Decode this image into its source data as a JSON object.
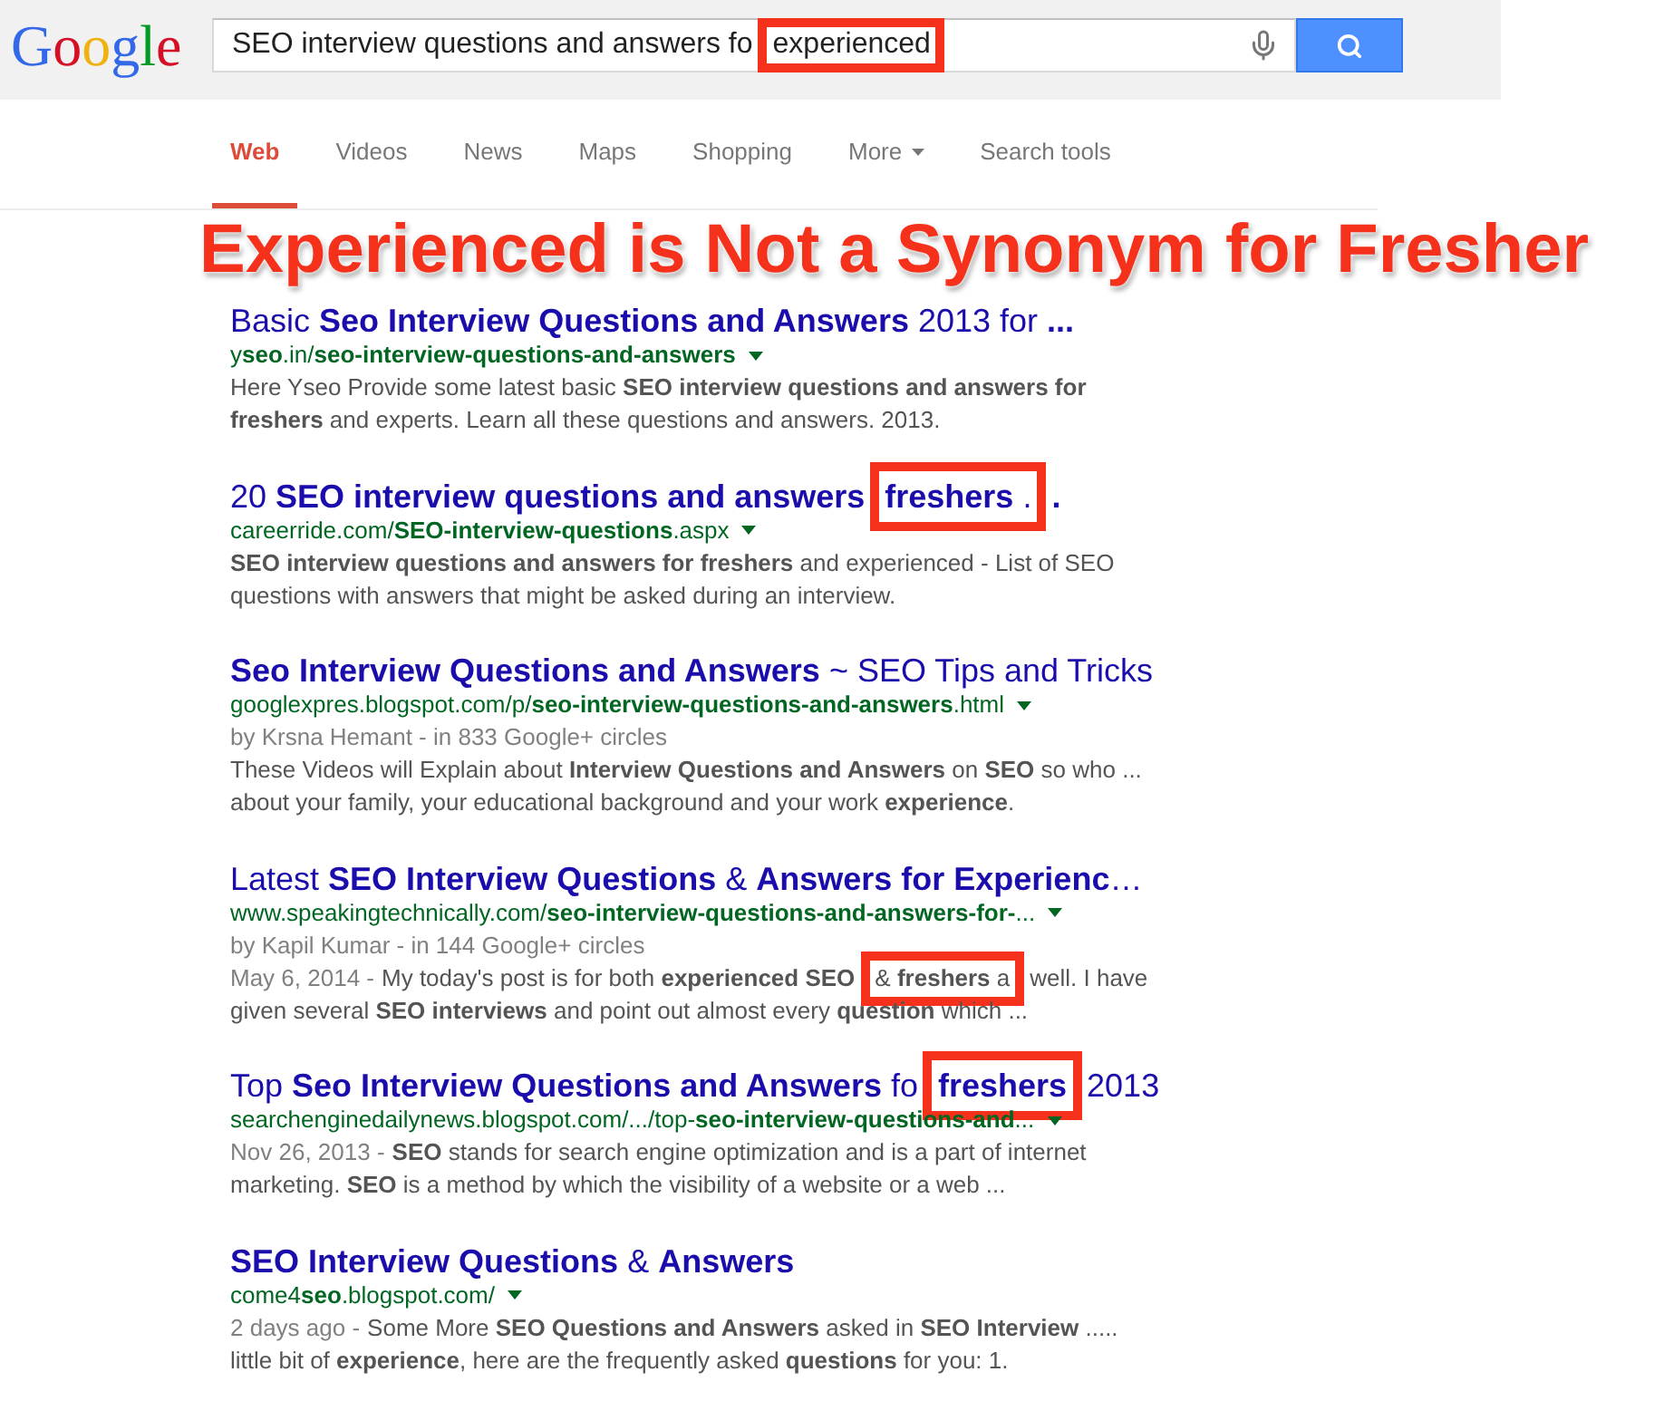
{
  "header": {
    "logo": "Google",
    "search": {
      "query": [
        {
          "text": "SEO interview questions and answers fo",
          "highlighted": false
        },
        {
          "text": "experienced",
          "highlighted": true
        }
      ]
    }
  },
  "tabs": [
    {
      "label": "Web",
      "selected": true,
      "kind": "tab"
    },
    {
      "label": "Videos",
      "selected": false,
      "kind": "tab"
    },
    {
      "label": "News",
      "selected": false,
      "kind": "tab"
    },
    {
      "label": "Maps",
      "selected": false,
      "kind": "tab"
    },
    {
      "label": "Shopping",
      "selected": false,
      "kind": "tab"
    },
    {
      "label": "More",
      "selected": false,
      "kind": "menu"
    },
    {
      "label": "Search tools",
      "selected": false,
      "kind": "tab"
    }
  ],
  "annotation": "Experienced is Not a Synonym for Fresher",
  "results": [
    {
      "title": [
        {
          "text": "Basic **Seo Interview Questions and Answers** 2013 for **...**",
          "highlighted": false
        }
      ],
      "url": "y**seo**.in/**seo-interview-questions-and-answers**",
      "snippet": [
        {
          "text": "Here Yseo Provide some latest basic **SEO interview questions and answers for freshers** and experts. Learn all these questions and answers. 2013.",
          "highlighted": false
        }
      ]
    },
    {
      "title": [
        {
          "text": "20 **SEO interview questions and answers**",
          "highlighted": false
        },
        {
          "text": "**freshers** .",
          "highlighted": true
        },
        {
          "text": "**.**",
          "highlighted": false
        }
      ],
      "url": "careerride.com/**SEO-interview-questions**.aspx",
      "snippet": [
        {
          "text": "**SEO interview questions and answers for freshers** and experienced - List of SEO questions with answers that might be asked during an interview.",
          "highlighted": false
        }
      ]
    },
    {
      "title": [
        {
          "text": "**Seo Interview Questions and Answers** ~ SEO Tips and Tricks",
          "highlighted": false
        }
      ],
      "url": "googlexpres.blogspot.com/p/**seo-interview-questions-and-answers**.html",
      "byline": "by Krsna Hemant - in 833 Google+ circles",
      "snippet": [
        {
          "text": "These Videos will Explain about **Interview Questions and Answers** on **SEO** so who ... about your family, your educational background and your work **experience**.",
          "highlighted": false
        }
      ]
    },
    {
      "title": [
        {
          "text": "Latest **SEO Interview Questions** & **Answers for Experienc**…",
          "highlighted": false
        }
      ],
      "url": "www.speakingtechnically.com/**seo-interview-questions-and-answers-for-**...",
      "byline": "by Kapil Kumar - in 144 Google+ circles",
      "date": "May 6, 2014 -",
      "snippet": [
        {
          "text": "My today's post is for both **experienced SEO**",
          "highlighted": false
        },
        {
          "text": "& **freshers** a",
          "highlighted": true
        },
        {
          "text": "well. I have given several **SEO interviews** and point out almost every **question** which ...",
          "highlighted": false
        }
      ]
    },
    {
      "title": [
        {
          "text": "Top **Seo Interview Questions and Answers** fo",
          "highlighted": false
        },
        {
          "text": "**freshers**",
          "highlighted": true
        },
        {
          "text": "2013",
          "highlighted": false
        }
      ],
      "url": "searchenginedailynews.blogspot.com/.../top-**seo-interview-questions-and**...",
      "date": "Nov 26, 2013 -",
      "snippet": [
        {
          "text": "**SEO** stands for search engine optimization and is a part of internet marketing. **SEO** is a method by which the visibility of a website or a web ...",
          "highlighted": false
        }
      ]
    },
    {
      "title": [
        {
          "text": "**SEO Interview Questions** & **Answers**",
          "highlighted": false
        }
      ],
      "url": "come4**seo**.blogspot.com/",
      "date": "2 days ago -",
      "snippet": [
        {
          "text": "Some More **SEO Questions and Answers** asked in **SEO Interview** ..... little bit of **experience**, here are the frequently asked **questions** for you: 1.",
          "highlighted": false
        }
      ]
    }
  ]
}
